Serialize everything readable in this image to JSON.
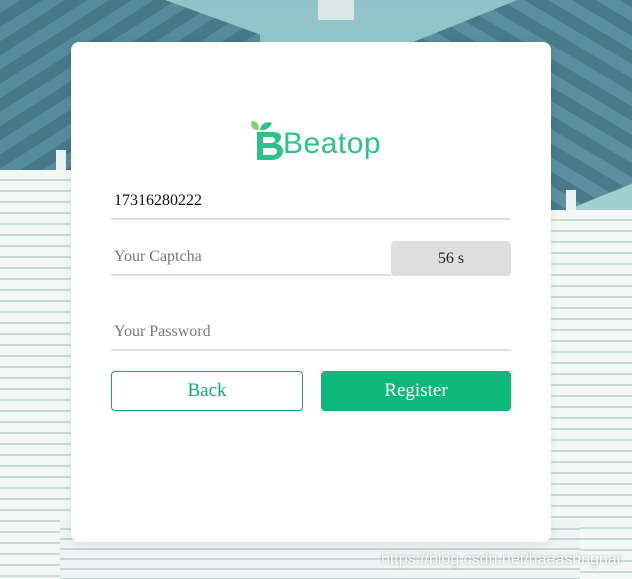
{
  "brand": {
    "name": "Beatop",
    "logo_icon": "beatop-leaf-b-logo",
    "color": "#2ec28a"
  },
  "form": {
    "phone": {
      "value": "17316280222",
      "placeholder": ""
    },
    "captcha": {
      "value": "",
      "placeholder": "Your Captcha"
    },
    "countdown_label": "56 s",
    "password": {
      "value": "",
      "placeholder": "Your Password"
    }
  },
  "buttons": {
    "back_label": "Back",
    "register_label": "Register"
  },
  "colors": {
    "accent": "#0db87b",
    "countdown_bg": "#dedede"
  },
  "watermark": "https://blog.csdn.net/haeasringnar"
}
